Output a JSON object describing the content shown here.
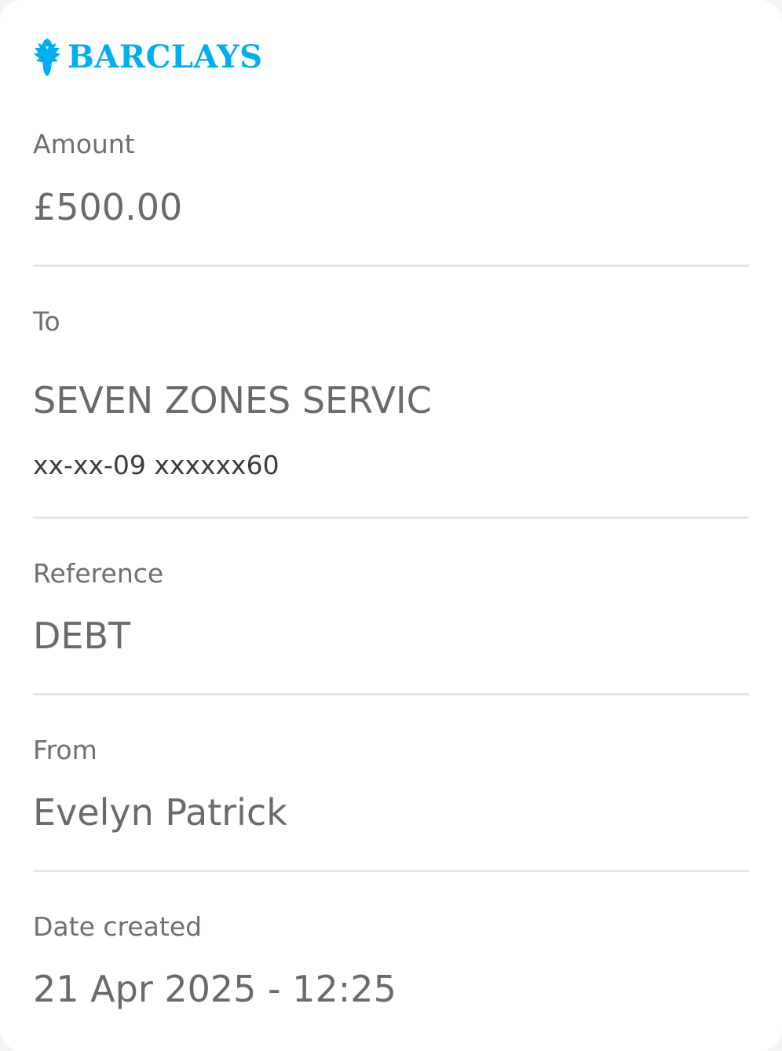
{
  "brand": {
    "name": "BARCLAYS",
    "icon": "eagle-icon",
    "color": "#00aeef"
  },
  "amount": {
    "label": "Amount",
    "value": "£500.00"
  },
  "to": {
    "label": "To",
    "name": "SEVEN ZONES SERVIC",
    "account": "xx-xx-09 xxxxxx60"
  },
  "reference": {
    "label": "Reference",
    "value": "DEBT"
  },
  "from": {
    "label": "From",
    "value": "Evelyn Patrick"
  },
  "date_created": {
    "label": "Date created",
    "value": "21 Apr 2025 - 12:25"
  }
}
